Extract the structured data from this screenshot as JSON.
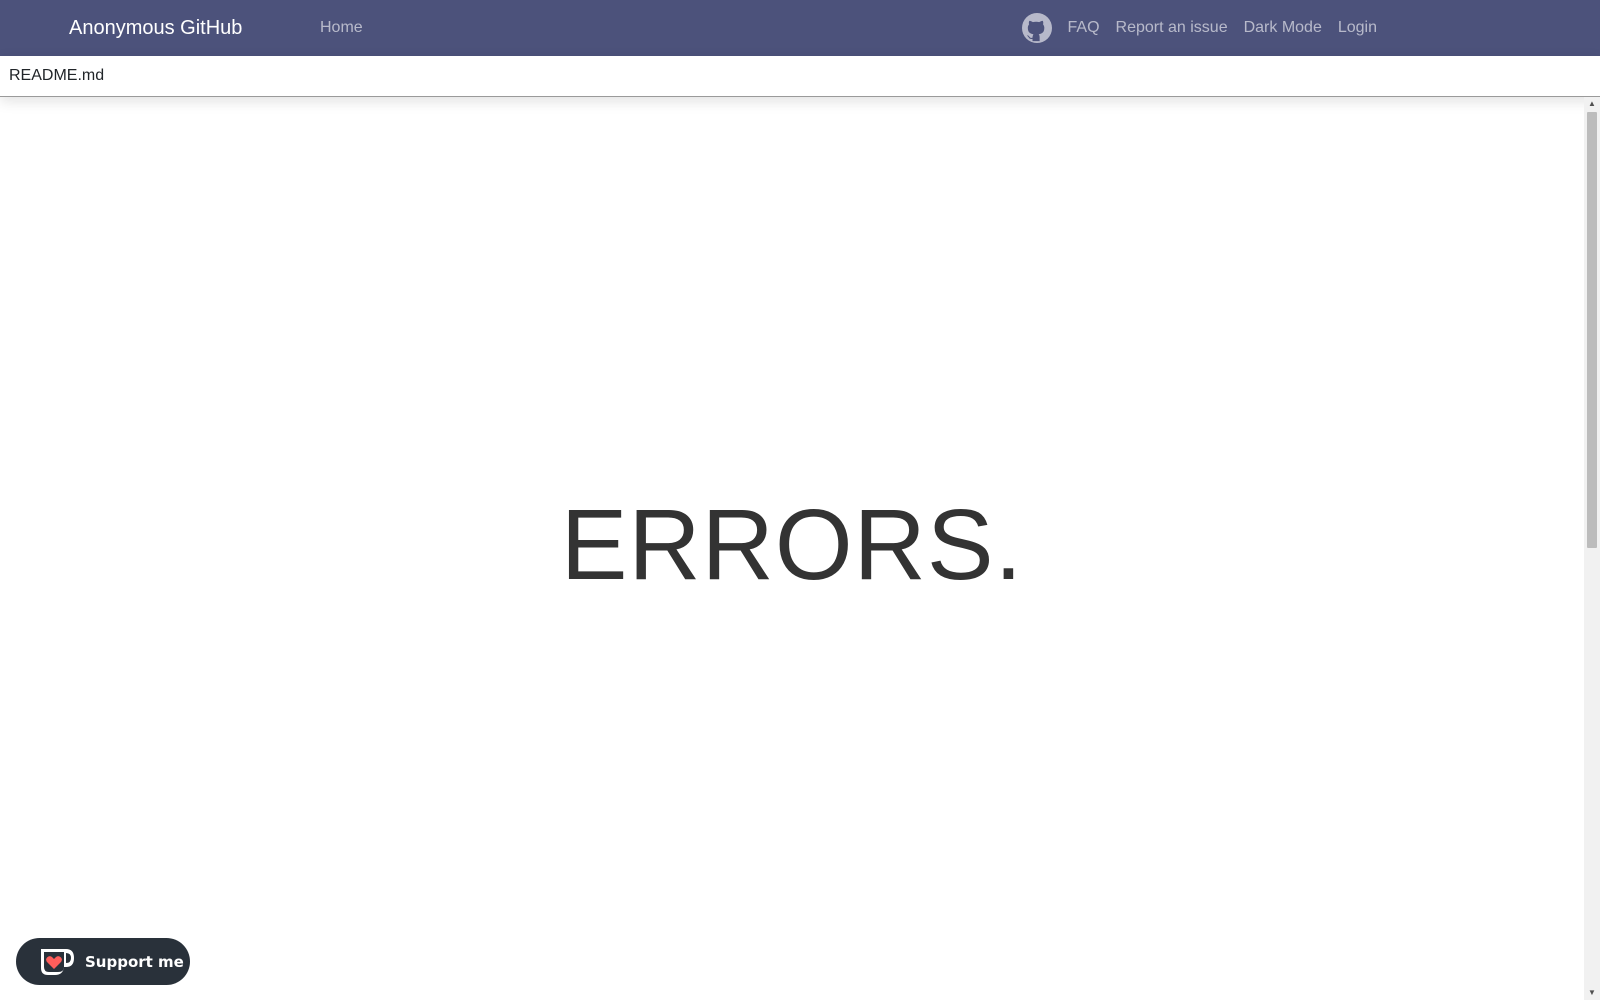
{
  "navbar": {
    "brand": "Anonymous GitHub",
    "left_links": [
      {
        "label": "Home"
      }
    ],
    "right_links": [
      {
        "label": "FAQ"
      },
      {
        "label": "Report an issue"
      },
      {
        "label": "Dark Mode"
      },
      {
        "label": "Login"
      }
    ],
    "github_icon": "github-icon",
    "background": "#4c527b"
  },
  "filebar": {
    "filename": "README.md"
  },
  "main": {
    "heading": "ERRORS."
  },
  "support_button": {
    "label": "Support me",
    "icon": "kofi-cup-icon",
    "heart_color": "#ff5e5b",
    "background": "#29313a"
  }
}
